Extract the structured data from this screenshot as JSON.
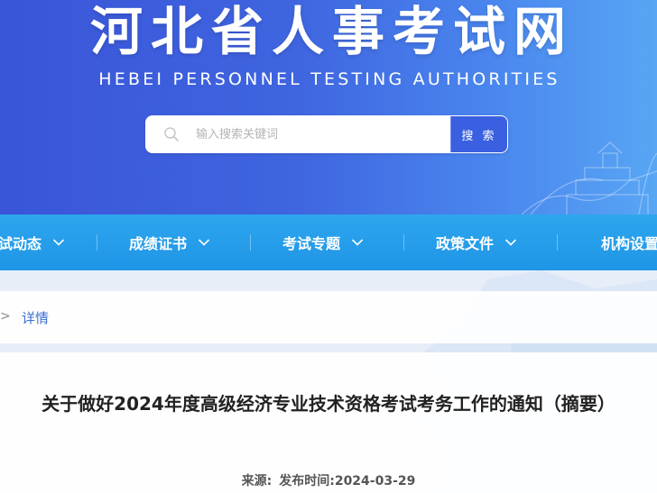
{
  "header": {
    "title": "河北省人事考试网",
    "subtitle": "HEBEI PERSONNEL TESTING AUTHORITIES",
    "search": {
      "placeholder": "输入搜索关键词",
      "button_label": "搜 索",
      "icon": "search-icon"
    },
    "colors": {
      "banner_start": "#3a55d8",
      "banner_end": "#58a6f4",
      "search_button": "#3a5fe0"
    }
  },
  "nav": {
    "items": [
      {
        "label": "试动态",
        "icon": "chevron-down-icon"
      },
      {
        "label": "成绩证书",
        "icon": "chevron-down-icon"
      },
      {
        "label": "考试专题",
        "icon": "chevron-down-icon"
      },
      {
        "label": "政策文件",
        "icon": "chevron-down-icon"
      },
      {
        "label": "机构设置"
      }
    ],
    "color": "#1f95e6"
  },
  "breadcrumb": {
    "separator": ">",
    "current": "详情"
  },
  "article": {
    "title": "关于做好2024年度高级经济专业技术资格考试考务工作的通知（摘要）",
    "source_label": "来源:",
    "date_label": "发布时间:",
    "date": "2024-03-29"
  }
}
